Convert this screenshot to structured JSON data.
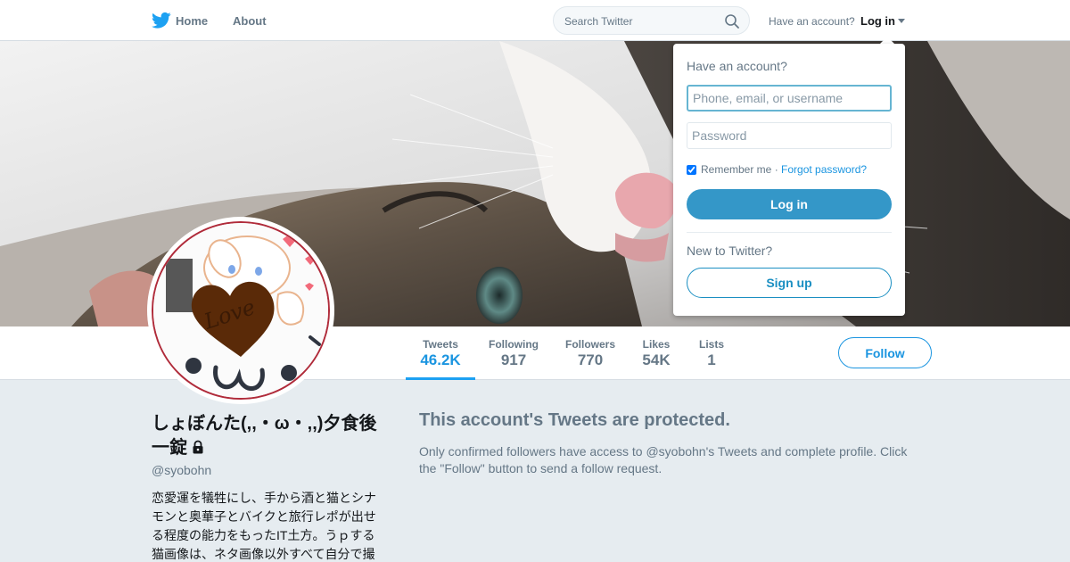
{
  "nav": {
    "home_label": "Home",
    "about_label": "About",
    "search_placeholder": "Search Twitter",
    "have_account": "Have an account?",
    "login_label": "Log in"
  },
  "profile": {
    "name": "しょぼんた(,,・ω・,,)夕食後一錠",
    "handle": "@syobohn",
    "bio": "恋愛運を犠牲にし、手から酒と猫とシナモンと奥華子とバイクと旅行レポが出せる程度の能力をもったIT土方。うｐする猫画像は、ネタ画像以外すべて自分で撮",
    "avatar_text": "Love"
  },
  "stats": [
    {
      "label": "Tweets",
      "value": "46.2K",
      "active": true
    },
    {
      "label": "Following",
      "value": "917",
      "active": false
    },
    {
      "label": "Followers",
      "value": "770",
      "active": false
    },
    {
      "label": "Likes",
      "value": "54K",
      "active": false
    },
    {
      "label": "Lists",
      "value": "1",
      "active": false
    }
  ],
  "follow_label": "Follow",
  "protected": {
    "title": "This account's Tweets are protected.",
    "body": "Only confirmed followers have access to @syobohn's Tweets and complete profile. Click the \"Follow\" button to send a follow request."
  },
  "login_dropdown": {
    "heading": "Have an account?",
    "username_placeholder": "Phone, email, or username",
    "password_placeholder": "Password",
    "remember_label": "Remember me",
    "separator": " · ",
    "forgot_label": "Forgot password?",
    "login_button": "Log in",
    "new_label": "New to Twitter?",
    "signup_button": "Sign up"
  },
  "colors": {
    "brand_blue": "#1da1f2",
    "link_blue": "#1b95e0",
    "login_button": "#3497c8",
    "page_bg": "#e6ecf0"
  },
  "icons": {
    "logo": "twitter-bird-icon",
    "search": "search-icon",
    "caret": "caret-down-icon",
    "lock": "lock-icon"
  }
}
